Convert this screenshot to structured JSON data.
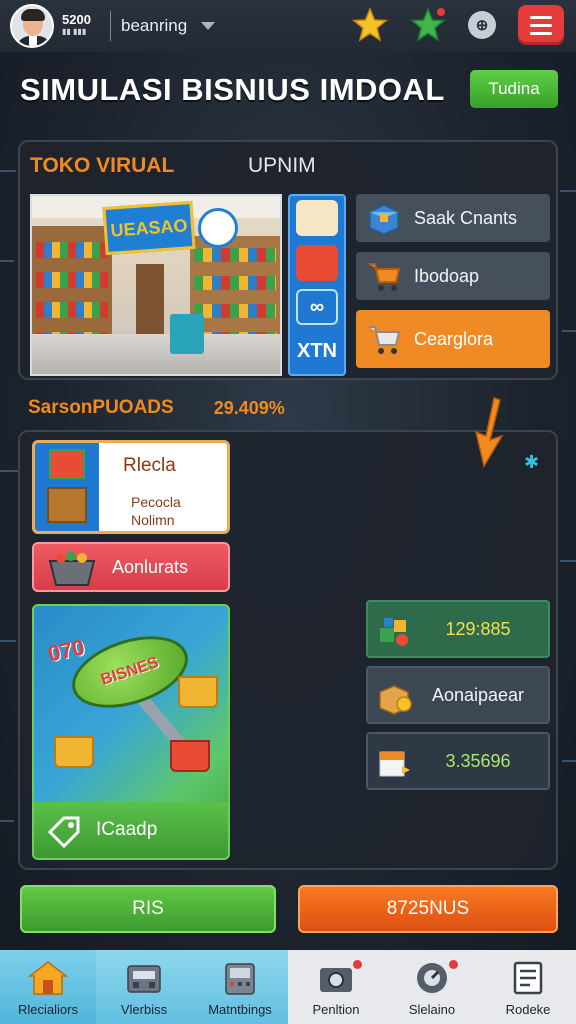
{
  "topbar": {
    "score": "5200",
    "sub_label": "▮▮ ▮▮▮",
    "status": "beanring",
    "icons": [
      "star-icon",
      "green-star-icon",
      "info-icon",
      "hamburger-menu-icon"
    ]
  },
  "header": {
    "title": "SIMULASI BISNIUS IMDOAL",
    "badge": "Tudina"
  },
  "store": {
    "label": "TOKO VIRUAL",
    "update": "UPNIM",
    "sign_text": "UEASAO",
    "categories": [
      "shop-icon",
      "gift-box-icon",
      "link-icon",
      "kit-icon"
    ],
    "category_texts": [
      "",
      "",
      "∞",
      "ΧΤΝ"
    ],
    "actions": [
      {
        "label": "Saak Cnants",
        "icon": "box-icon",
        "active": false
      },
      {
        "label": "Ibodoap",
        "icon": "cart-icon",
        "active": false
      },
      {
        "label": "Cearglora",
        "icon": "cart-icon",
        "active": true
      }
    ]
  },
  "stats": {
    "label": "SarsonPUOADS",
    "value": "29.409%"
  },
  "main": {
    "products_card": {
      "title": "Rlecla",
      "subtitle_1": "Pecocla",
      "subtitle_2": "Nolimn"
    },
    "red_card": {
      "label": "Aonlurats"
    },
    "promo_card": {
      "promo": "070",
      "tag": "BISNES",
      "bottom_label": "ICaadp"
    },
    "right_stats": [
      {
        "value": "129:885",
        "icon": "toy-blocks-icon",
        "style": "green"
      },
      {
        "value": "Aonaipaear",
        "icon": "box-coin-icon",
        "style": "plain"
      },
      {
        "value": "3.35696",
        "icon": "package-icon",
        "style": "dark"
      }
    ]
  },
  "buttons": {
    "primary": "RIS",
    "secondary": "8725NUS"
  },
  "nav": [
    {
      "label": "Rlecialiors",
      "icon": "home-icon",
      "notify": false
    },
    {
      "label": "Vlerbiss",
      "icon": "register-icon",
      "notify": false
    },
    {
      "label": "Matntbings",
      "icon": "machine-icon",
      "notify": false
    },
    {
      "label": "Penltion",
      "icon": "camera-icon",
      "notify": true
    },
    {
      "label": "Slelaino",
      "icon": "settings-dial-icon",
      "notify": true
    },
    {
      "label": "Rodeke",
      "icon": "document-icon",
      "notify": false
    }
  ],
  "colors": {
    "accent_orange": "#f28a1e",
    "accent_green": "#4cb33a",
    "menu_red": "#e53b3b",
    "panel_bg": "#1e242d"
  }
}
